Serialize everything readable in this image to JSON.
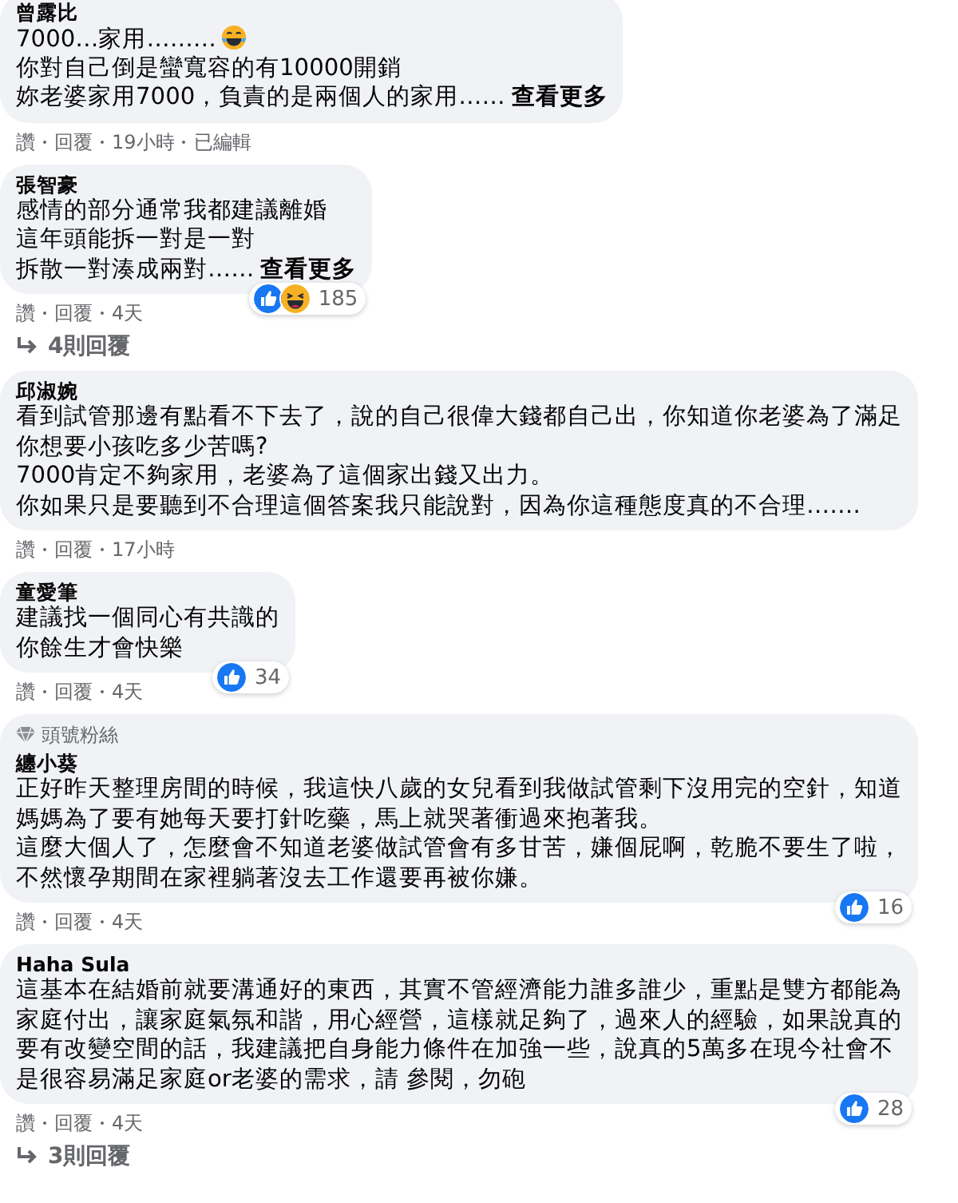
{
  "comments": [
    {
      "author": "曾露比",
      "lines": [
        {
          "text": "7000…家用………",
          "emoji": {
            "kind": "tears_of_joy"
          }
        },
        "你對自己倒是蠻寬容的有10000開銷",
        "妳老婆家用7000，負責的是兩個人的家用……"
      ],
      "see_more": "查看更多",
      "actions": [
        "讚",
        "回覆",
        "19小時",
        "已編輯"
      ]
    },
    {
      "author": "張智豪",
      "lines": [
        "感情的部分通常我都建議離婚",
        "這年頭能拆一對是一對",
        "拆散一對湊成兩對……"
      ],
      "see_more": "查看更多",
      "reactions": {
        "icons": [
          {
            "kind": "like"
          },
          {
            "kind": "haha"
          }
        ],
        "count": "185"
      },
      "actions": [
        "讚",
        "回覆",
        "4天"
      ],
      "replies": "4則回覆"
    },
    {
      "author": "邱淑婉",
      "lines": [
        "看到試管那邊有點看不下去了，說的自己很偉大錢都自己出，你知道你老婆為了滿足",
        "你想要小孩吃多少苦嗎?",
        "7000肯定不夠家用，老婆為了這個家出錢又出力。",
        "你如果只是要聽到不合理這個答案我只能說對，因為你這種態度真的不合理……."
      ],
      "actions": [
        "讚",
        "回覆",
        "17小時"
      ]
    },
    {
      "author": "童愛筆",
      "lines": [
        "建議找一個同心有共識的",
        "你餘生才會快樂"
      ],
      "reactions": {
        "icons": [
          {
            "kind": "like"
          }
        ],
        "count": "34"
      },
      "actions": [
        "讚",
        "回覆",
        "4天"
      ]
    },
    {
      "fan_badge": "頭號粉絲",
      "author": "纏小葵",
      "lines": [
        "正好昨天整理房間的時候，我這快八歲的女兒看到我做試管剩下沒用完的空針，知道",
        "媽媽為了要有她每天要打針吃藥，馬上就哭著衝過來抱著我。",
        "這麼大個人了，怎麼會不知道老婆做試管會有多甘苦，嫌個屁啊，乾脆不要生了啦，",
        "不然懷孕期間在家裡躺著沒去工作還要再被你嫌。"
      ],
      "reactions": {
        "icons": [
          {
            "kind": "like"
          }
        ],
        "count": "16"
      },
      "actions": [
        "讚",
        "回覆",
        "4天"
      ]
    },
    {
      "author": "Haha Sula",
      "lines": [
        "這基本在結婚前就要溝通好的東西，其實不管經濟能力誰多誰少，重點是雙方都能為",
        "家庭付出，讓家庭氣氛和諧，用心經營，這樣就足夠了，過來人的經驗，如果說真的",
        "要有改變空間的話，我建議把自身能力條件在加強一些，說真的5萬多在現今社會不",
        "是很容易滿足家庭or老婆的需求，請 參閱，勿砲"
      ],
      "reactions": {
        "icons": [
          {
            "kind": "like"
          }
        ],
        "count": "28"
      },
      "actions": [
        "讚",
        "回覆",
        "4天"
      ],
      "replies": "3則回覆"
    }
  ]
}
